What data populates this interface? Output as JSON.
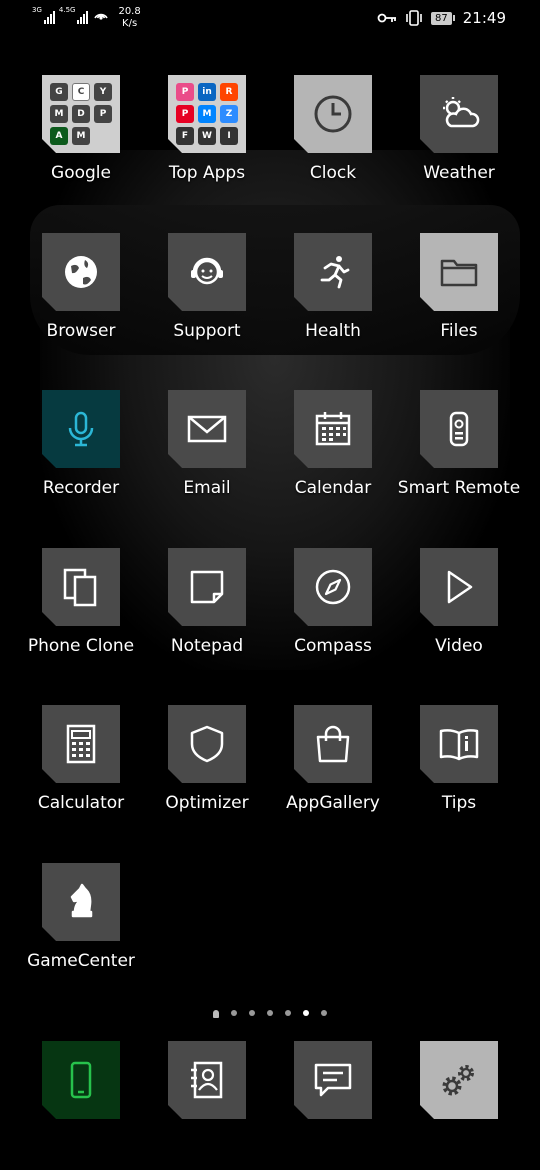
{
  "status_bar": {
    "sim1": "3G",
    "sim2": "4.5G",
    "net_speed_value": "20.8",
    "net_speed_unit": "K/s",
    "battery": "87",
    "time": "21:49",
    "icons": [
      "key-icon",
      "vibrate-icon",
      "battery-icon"
    ]
  },
  "apps": [
    {
      "label": "Google",
      "icon": "folder-google"
    },
    {
      "label": "Top Apps",
      "icon": "folder-top-apps"
    },
    {
      "label": "Clock",
      "icon": "clock-icon"
    },
    {
      "label": "Weather",
      "icon": "weather-icon"
    },
    {
      "label": "Browser",
      "icon": "globe-icon"
    },
    {
      "label": "Support",
      "icon": "headset-icon"
    },
    {
      "label": "Health",
      "icon": "runner-icon"
    },
    {
      "label": "Files",
      "icon": "folder-icon"
    },
    {
      "label": "Recorder",
      "icon": "microphone-icon"
    },
    {
      "label": "Email",
      "icon": "envelope-icon"
    },
    {
      "label": "Calendar",
      "icon": "calendar-icon"
    },
    {
      "label": "Smart Remote",
      "icon": "remote-icon"
    },
    {
      "label": "Phone Clone",
      "icon": "clone-icon"
    },
    {
      "label": "Notepad",
      "icon": "note-icon"
    },
    {
      "label": "Compass",
      "icon": "compass-icon"
    },
    {
      "label": "Video",
      "icon": "play-icon"
    },
    {
      "label": "Calculator",
      "icon": "calculator-icon"
    },
    {
      "label": "Optimizer",
      "icon": "shield-icon"
    },
    {
      "label": "AppGallery",
      "icon": "shopping-bag-icon"
    },
    {
      "label": "Tips",
      "icon": "book-info-icon"
    },
    {
      "label": "GameCenter",
      "icon": "chess-knight-icon"
    }
  ],
  "google_folder": [
    "G",
    "C",
    "Y",
    "M",
    "D",
    "P",
    "A",
    "M"
  ],
  "top_apps_folder": [
    "P",
    "in",
    "R",
    "P",
    "M",
    "Z",
    "F",
    "W",
    "I"
  ],
  "dock": [
    {
      "icon": "phone-icon"
    },
    {
      "icon": "contacts-icon"
    },
    {
      "icon": "messages-icon"
    },
    {
      "icon": "settings-gear-icon"
    }
  ],
  "page_indicator": {
    "count": 7,
    "active": 5
  },
  "colors": {
    "tile": "#4a4a4a",
    "tile_light": "#b5b5b5",
    "accent_teal": "#2bb7d6",
    "accent_green": "#27c24c"
  }
}
